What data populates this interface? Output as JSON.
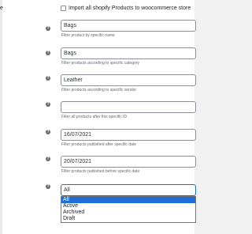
{
  "top_label_fragment": "e",
  "import_all": {
    "label": "Import all shopify Products to woocommerce store",
    "checked": false
  },
  "fields": [
    {
      "value": "Bags",
      "placeholder": "",
      "hint": "Filter product by specific name"
    },
    {
      "value": "Bags",
      "placeholder": "",
      "hint": "Filter products according to specific category"
    },
    {
      "value": "Leather",
      "placeholder": "",
      "hint": "Filter products according to specific vendor"
    },
    {
      "value": "",
      "placeholder": "",
      "hint": "Filter all products after this specific ID"
    },
    {
      "value": "16/07/2021",
      "placeholder": "",
      "hint": "Filter products published after specific date"
    },
    {
      "value": "20/07/2021",
      "placeholder": "",
      "hint": "Filter products published before specific date"
    }
  ],
  "status_select": {
    "selected": "All",
    "options": [
      "All",
      "Active",
      "Archived",
      "Draft"
    ],
    "highlighted": "All"
  },
  "help_icon_glyph": "?",
  "colors": {
    "focus_border": "#2271b1",
    "option_highlight": "#1e6fd9"
  }
}
